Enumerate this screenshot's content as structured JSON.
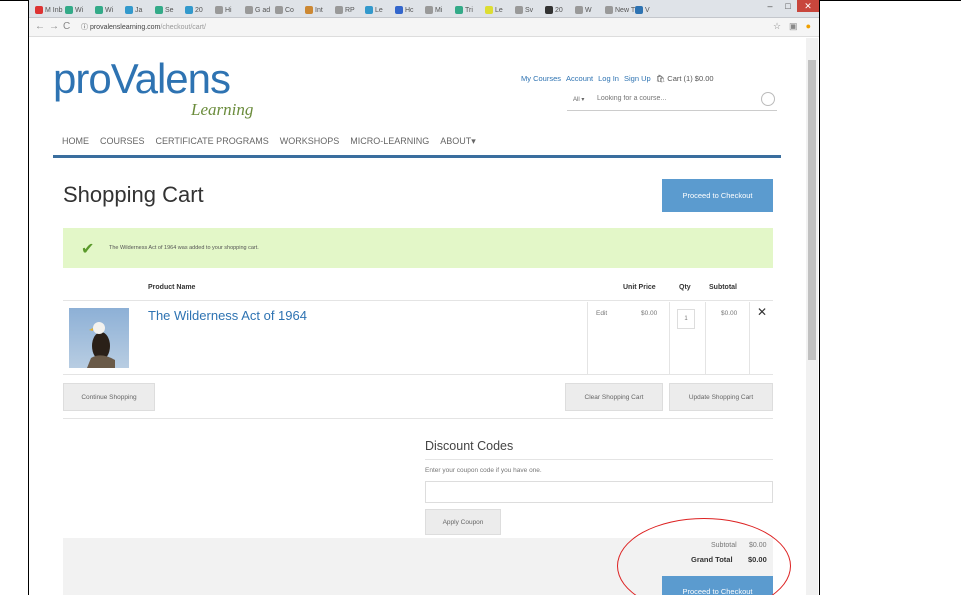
{
  "browser": {
    "tabs": [
      {
        "label": "M Inb",
        "color": "#d33"
      },
      {
        "label": "Wi",
        "color": "#3a8"
      },
      {
        "label": "Wi",
        "color": "#3a8"
      },
      {
        "label": "Ja",
        "color": "#39c"
      },
      {
        "label": "Se",
        "color": "#3a8"
      },
      {
        "label": "20",
        "color": "#39c"
      },
      {
        "label": "Hi",
        "color": "#999"
      },
      {
        "label": "G ad",
        "color": "#999"
      },
      {
        "label": "Co",
        "color": "#999"
      },
      {
        "label": "Int",
        "color": "#c83"
      },
      {
        "label": "RP",
        "color": "#999"
      },
      {
        "label": "Le",
        "color": "#39c"
      },
      {
        "label": "Hc",
        "color": "#36c"
      },
      {
        "label": "Mi",
        "color": "#999"
      },
      {
        "label": "Tri",
        "color": "#3a8"
      },
      {
        "label": "Le",
        "color": "#dd3"
      },
      {
        "label": "Sv",
        "color": "#999"
      },
      {
        "label": "20",
        "color": "#333"
      },
      {
        "label": "W",
        "color": "#999"
      },
      {
        "label": "New T",
        "color": "#999"
      },
      {
        "label": "V",
        "color": "#2e73b2"
      }
    ],
    "window_label": "",
    "url_domain": "provalenslearning.com",
    "url_path": "/checkout/cart/"
  },
  "site": {
    "logo_main": "proValens",
    "logo_sub": "Learning",
    "top_links": [
      "My Courses",
      "Account",
      "Log In",
      "Sign Up"
    ],
    "cart_label": "Cart (1) $0.00",
    "search_filter": "All",
    "search_placeholder": "Looking for a course...",
    "nav": [
      "HOME",
      "COURSES",
      "CERTIFICATE PROGRAMS",
      "WORKSHOPS",
      "MICRO-LEARNING",
      "ABOUT"
    ]
  },
  "cart": {
    "title": "Shopping Cart",
    "proceed_label": "Proceed to Checkout",
    "notice": "The Wilderness Act of 1964 was added to your shopping cart.",
    "columns": {
      "product": "Product Name",
      "unit_price": "Unit Price",
      "qty": "Qty",
      "subtotal": "Subtotal"
    },
    "item": {
      "name": "The Wilderness Act of 1964",
      "edit": "Edit",
      "unit_price": "$0.00",
      "qty": "1",
      "subtotal": "$0.00"
    },
    "continue_label": "Continue Shopping",
    "clear_label": "Clear Shopping Cart",
    "update_label": "Update Shopping Cart"
  },
  "discount": {
    "title": "Discount Codes",
    "instructions": "Enter your coupon code if you have one.",
    "apply_label": "Apply Coupon"
  },
  "totals": {
    "subtotal_label": "Subtotal",
    "subtotal_value": "$0.00",
    "grand_label": "Grand Total",
    "grand_value": "$0.00",
    "checkout_label": "Proceed to Checkout"
  },
  "colors": {
    "brand_blue": "#2e73b2",
    "button_blue": "#5b9bcf",
    "success_bg": "#e3f7c8",
    "annotation": "#dd2222"
  }
}
